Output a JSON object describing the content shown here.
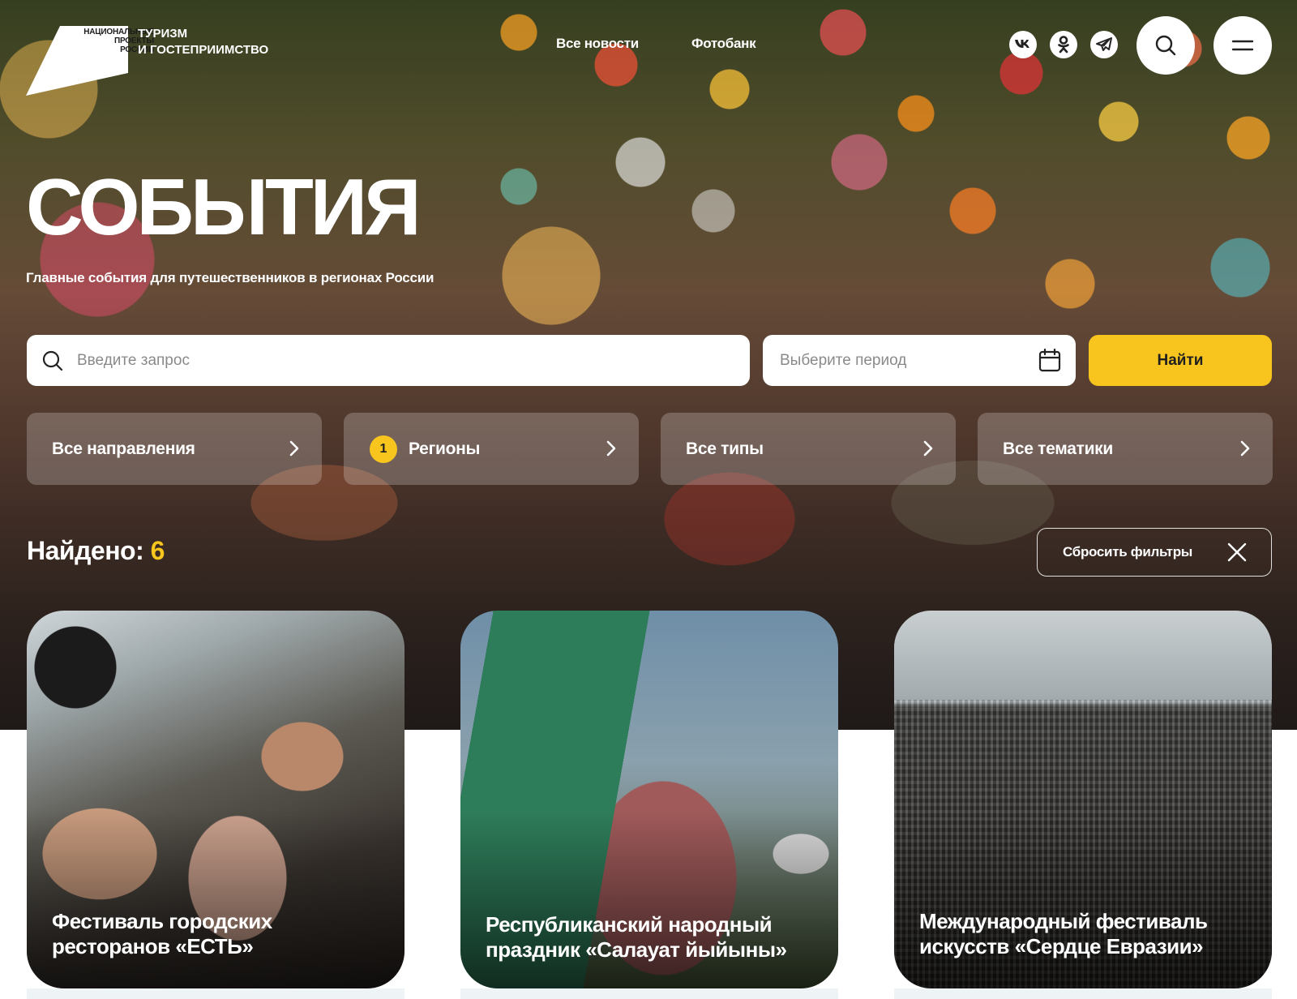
{
  "header": {
    "logo_small_lines": [
      "НАЦИОНАЛЬНЫЕ",
      "ПРОЕКТЫ",
      "РОССИИ"
    ],
    "logo_title_line1": "ТУРИЗМ",
    "logo_title_line2": "И ГОСТЕПРИИМСТВО",
    "nav": {
      "news": "Все новости",
      "photobank": "Фотобанк"
    },
    "social_icons": [
      "vk-icon",
      "odnoklassniki-icon",
      "telegram-icon"
    ],
    "search_icon": "search-icon",
    "menu_icon": "burger-menu-icon"
  },
  "page": {
    "title": "СОБЫТИЯ",
    "subtitle": "Главные события для путешественников в регионах России"
  },
  "search": {
    "query_placeholder": "Введите запрос",
    "query_value": "",
    "period_placeholder": "Выберите период",
    "period_value": "",
    "find_label": "Найти"
  },
  "filters": {
    "directions": "Все направления",
    "regions": "Регионы",
    "regions_badge": "1",
    "types": "Все типы",
    "topics": "Все тематики"
  },
  "results": {
    "found_label": "Найдено:",
    "found_count": "6",
    "reset_label": "Сбросить фильтры"
  },
  "cards": [
    {
      "title": "Фестиваль городских ресторанов «ЕСТЬ»"
    },
    {
      "title": "Республиканский народный праздник «Салауат йыйыны»"
    },
    {
      "title": "Международный фестиваль искусств «Сердце Евразии»"
    }
  ],
  "colors": {
    "accent": "#f7c51e",
    "white": "#ffffff",
    "strip": "#eef3f6"
  }
}
